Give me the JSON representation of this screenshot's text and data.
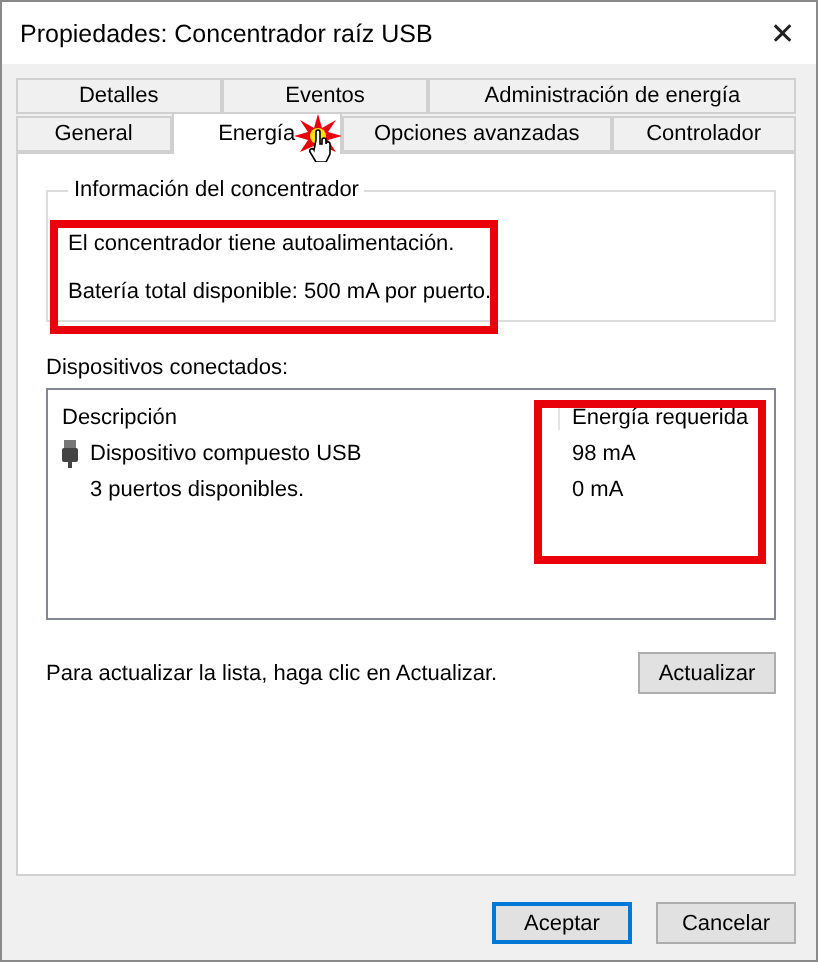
{
  "window": {
    "title": "Propiedades: Concentrador raíz USB",
    "close": "✕"
  },
  "tab_rows": [
    [
      {
        "label": "Detalles",
        "selected": false
      },
      {
        "label": "Eventos",
        "selected": false
      },
      {
        "label": "Administración de energía",
        "selected": false
      }
    ],
    [
      {
        "label": "General",
        "selected": false
      },
      {
        "label": "Energía",
        "selected": true
      },
      {
        "label": "Opciones avanzadas",
        "selected": false
      },
      {
        "label": "Controlador",
        "selected": false
      }
    ]
  ],
  "hub_info": {
    "title": "Información del concentrador",
    "lines": [
      "El concentrador tiene autoalimentación.",
      "Batería total disponible:  500 mA por puerto."
    ]
  },
  "devices": {
    "label": "Dispositivos conectados:",
    "columns": [
      "Descripción",
      "Energía requerida"
    ],
    "rows": [
      {
        "kind": "device",
        "description": "Dispositivo compuesto USB",
        "power": "98 mA"
      },
      {
        "kind": "ports",
        "description": "3 puertos disponibles.",
        "power": "0 mA"
      }
    ]
  },
  "refresh_hint": "Para actualizar la lista, haga clic en Actualizar.",
  "refresh_button": "Actualizar",
  "buttons": [
    {
      "label": "Aceptar",
      "default": true
    },
    {
      "label": "Cancelar",
      "default": false
    }
  ]
}
